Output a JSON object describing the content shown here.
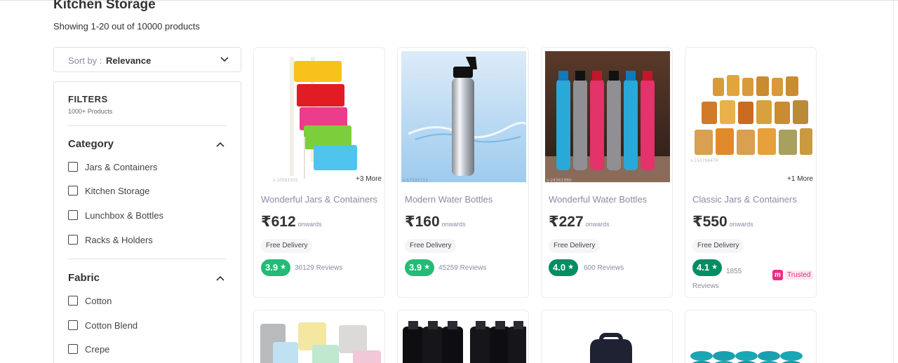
{
  "header": {
    "title": "Kitchen Storage",
    "count_text": "Showing 1-20 out of 10000 products"
  },
  "sort": {
    "label": "Sort by :",
    "value": "Relevance"
  },
  "filters": {
    "title": "FILTERS",
    "subtitle": "1000+ Products",
    "sections": [
      {
        "title": "Category",
        "options": [
          "Jars & Containers",
          "Kitchen Storage",
          "Lunchbox & Bottles",
          "Racks & Holders"
        ]
      },
      {
        "title": "Fabric",
        "options": [
          "Cotton",
          "Cotton Blend",
          "Crepe"
        ]
      }
    ]
  },
  "products": [
    {
      "name": "Wonderful Jars & Containers",
      "price": "₹612",
      "onwards": "onwards",
      "delivery": "Free Delivery",
      "rating": "3.9",
      "rating_color": "#23bb75",
      "reviews": "36129 Reviews",
      "more": "+3 More",
      "image": "plastic-drawer-rack"
    },
    {
      "name": "Modern Water Bottles",
      "price": "₹160",
      "onwards": "onwards",
      "delivery": "Free Delivery",
      "rating": "3.9",
      "rating_color": "#23bb75",
      "reviews": "45259 Reviews",
      "more": "",
      "image": "steel-water-bottle"
    },
    {
      "name": "Wonderful Water Bottles",
      "price": "₹227",
      "onwards": "onwards",
      "delivery": "Free Delivery",
      "rating": "4.0",
      "rating_color": "#038d63",
      "reviews": "600 Reviews",
      "more": "",
      "image": "colored-water-bottles"
    },
    {
      "name": "Classic Jars & Containers",
      "price": "₹550",
      "onwards": "onwards",
      "delivery": "Free Delivery",
      "rating": "4.1",
      "rating_color": "#038d63",
      "reviews": "1855 Reviews",
      "more": "+1 More",
      "trusted": "Trusted",
      "image": "glass-jars"
    }
  ],
  "colors": {
    "accent": "#9f2089",
    "rating_green": "#23bb75",
    "rating_dark_green": "#038d63",
    "trusted_pink": "#e92e84"
  }
}
